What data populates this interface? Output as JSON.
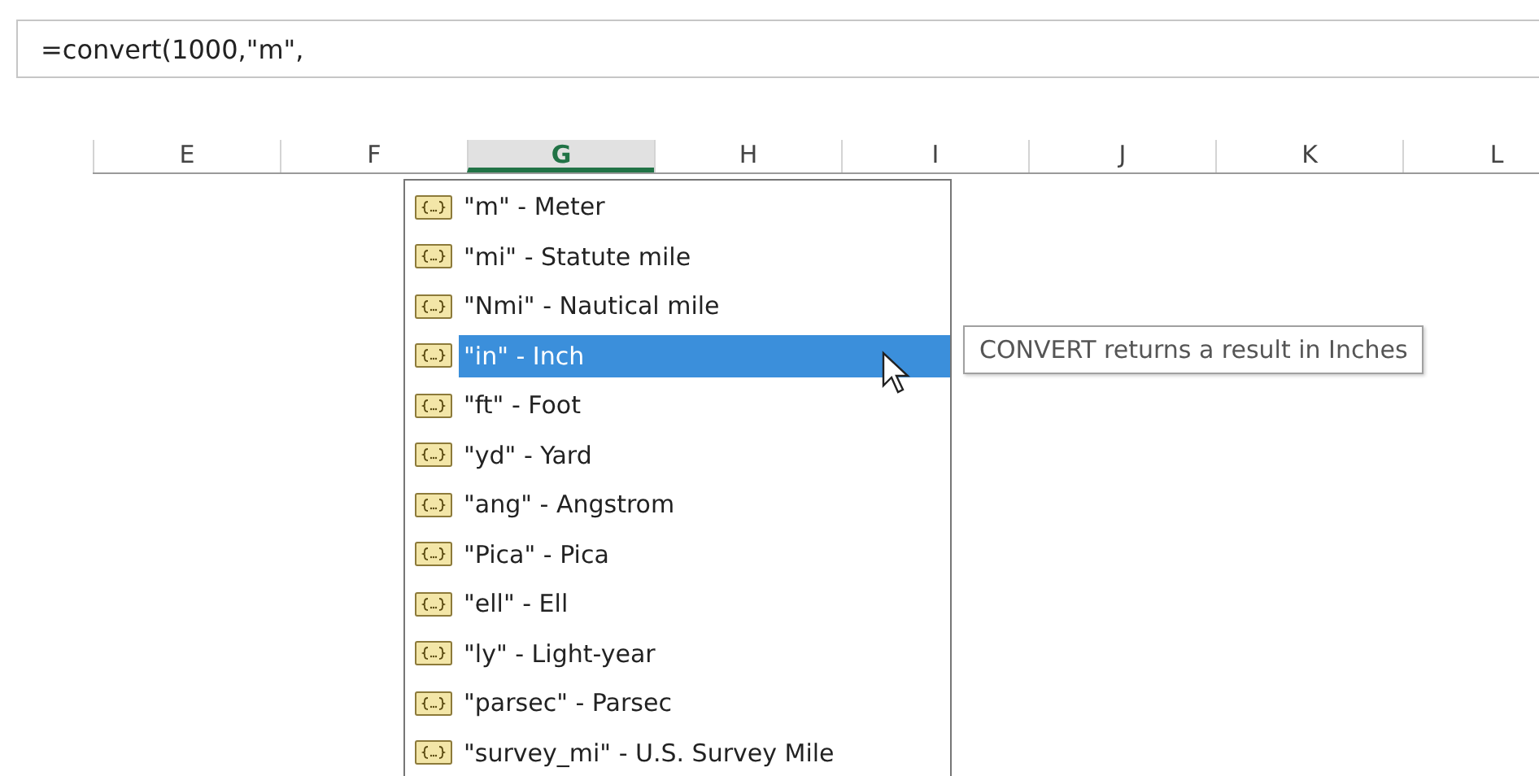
{
  "formula_bar": {
    "value": "=convert(1000,\"m\","
  },
  "columns": [
    {
      "label": "E",
      "selected": false
    },
    {
      "label": "F",
      "selected": false
    },
    {
      "label": "G",
      "selected": true
    },
    {
      "label": "H",
      "selected": false
    },
    {
      "label": "I",
      "selected": false
    },
    {
      "label": "J",
      "selected": false
    },
    {
      "label": "K",
      "selected": false
    },
    {
      "label": "L",
      "selected": false
    }
  ],
  "autocomplete": {
    "items": [
      {
        "label": "\"m\" - Meter",
        "selected": false
      },
      {
        "label": "\"mi\" - Statute mile",
        "selected": false
      },
      {
        "label": "\"Nmi\" - Nautical mile",
        "selected": false
      },
      {
        "label": "\"in\" - Inch",
        "selected": true
      },
      {
        "label": "\"ft\" - Foot",
        "selected": false
      },
      {
        "label": "\"yd\" - Yard",
        "selected": false
      },
      {
        "label": "\"ang\" - Angstrom",
        "selected": false
      },
      {
        "label": "\"Pica\" - Pica",
        "selected": false
      },
      {
        "label": "\"ell\" - Ell",
        "selected": false
      },
      {
        "label": "\"ly\" - Light-year",
        "selected": false
      },
      {
        "label": "\"parsec\" - Parsec",
        "selected": false
      },
      {
        "label": "\"survey_mi\" - U.S. Survey Mile",
        "selected": false
      }
    ]
  },
  "tooltip": {
    "text": "CONVERT returns a result in Inches"
  }
}
